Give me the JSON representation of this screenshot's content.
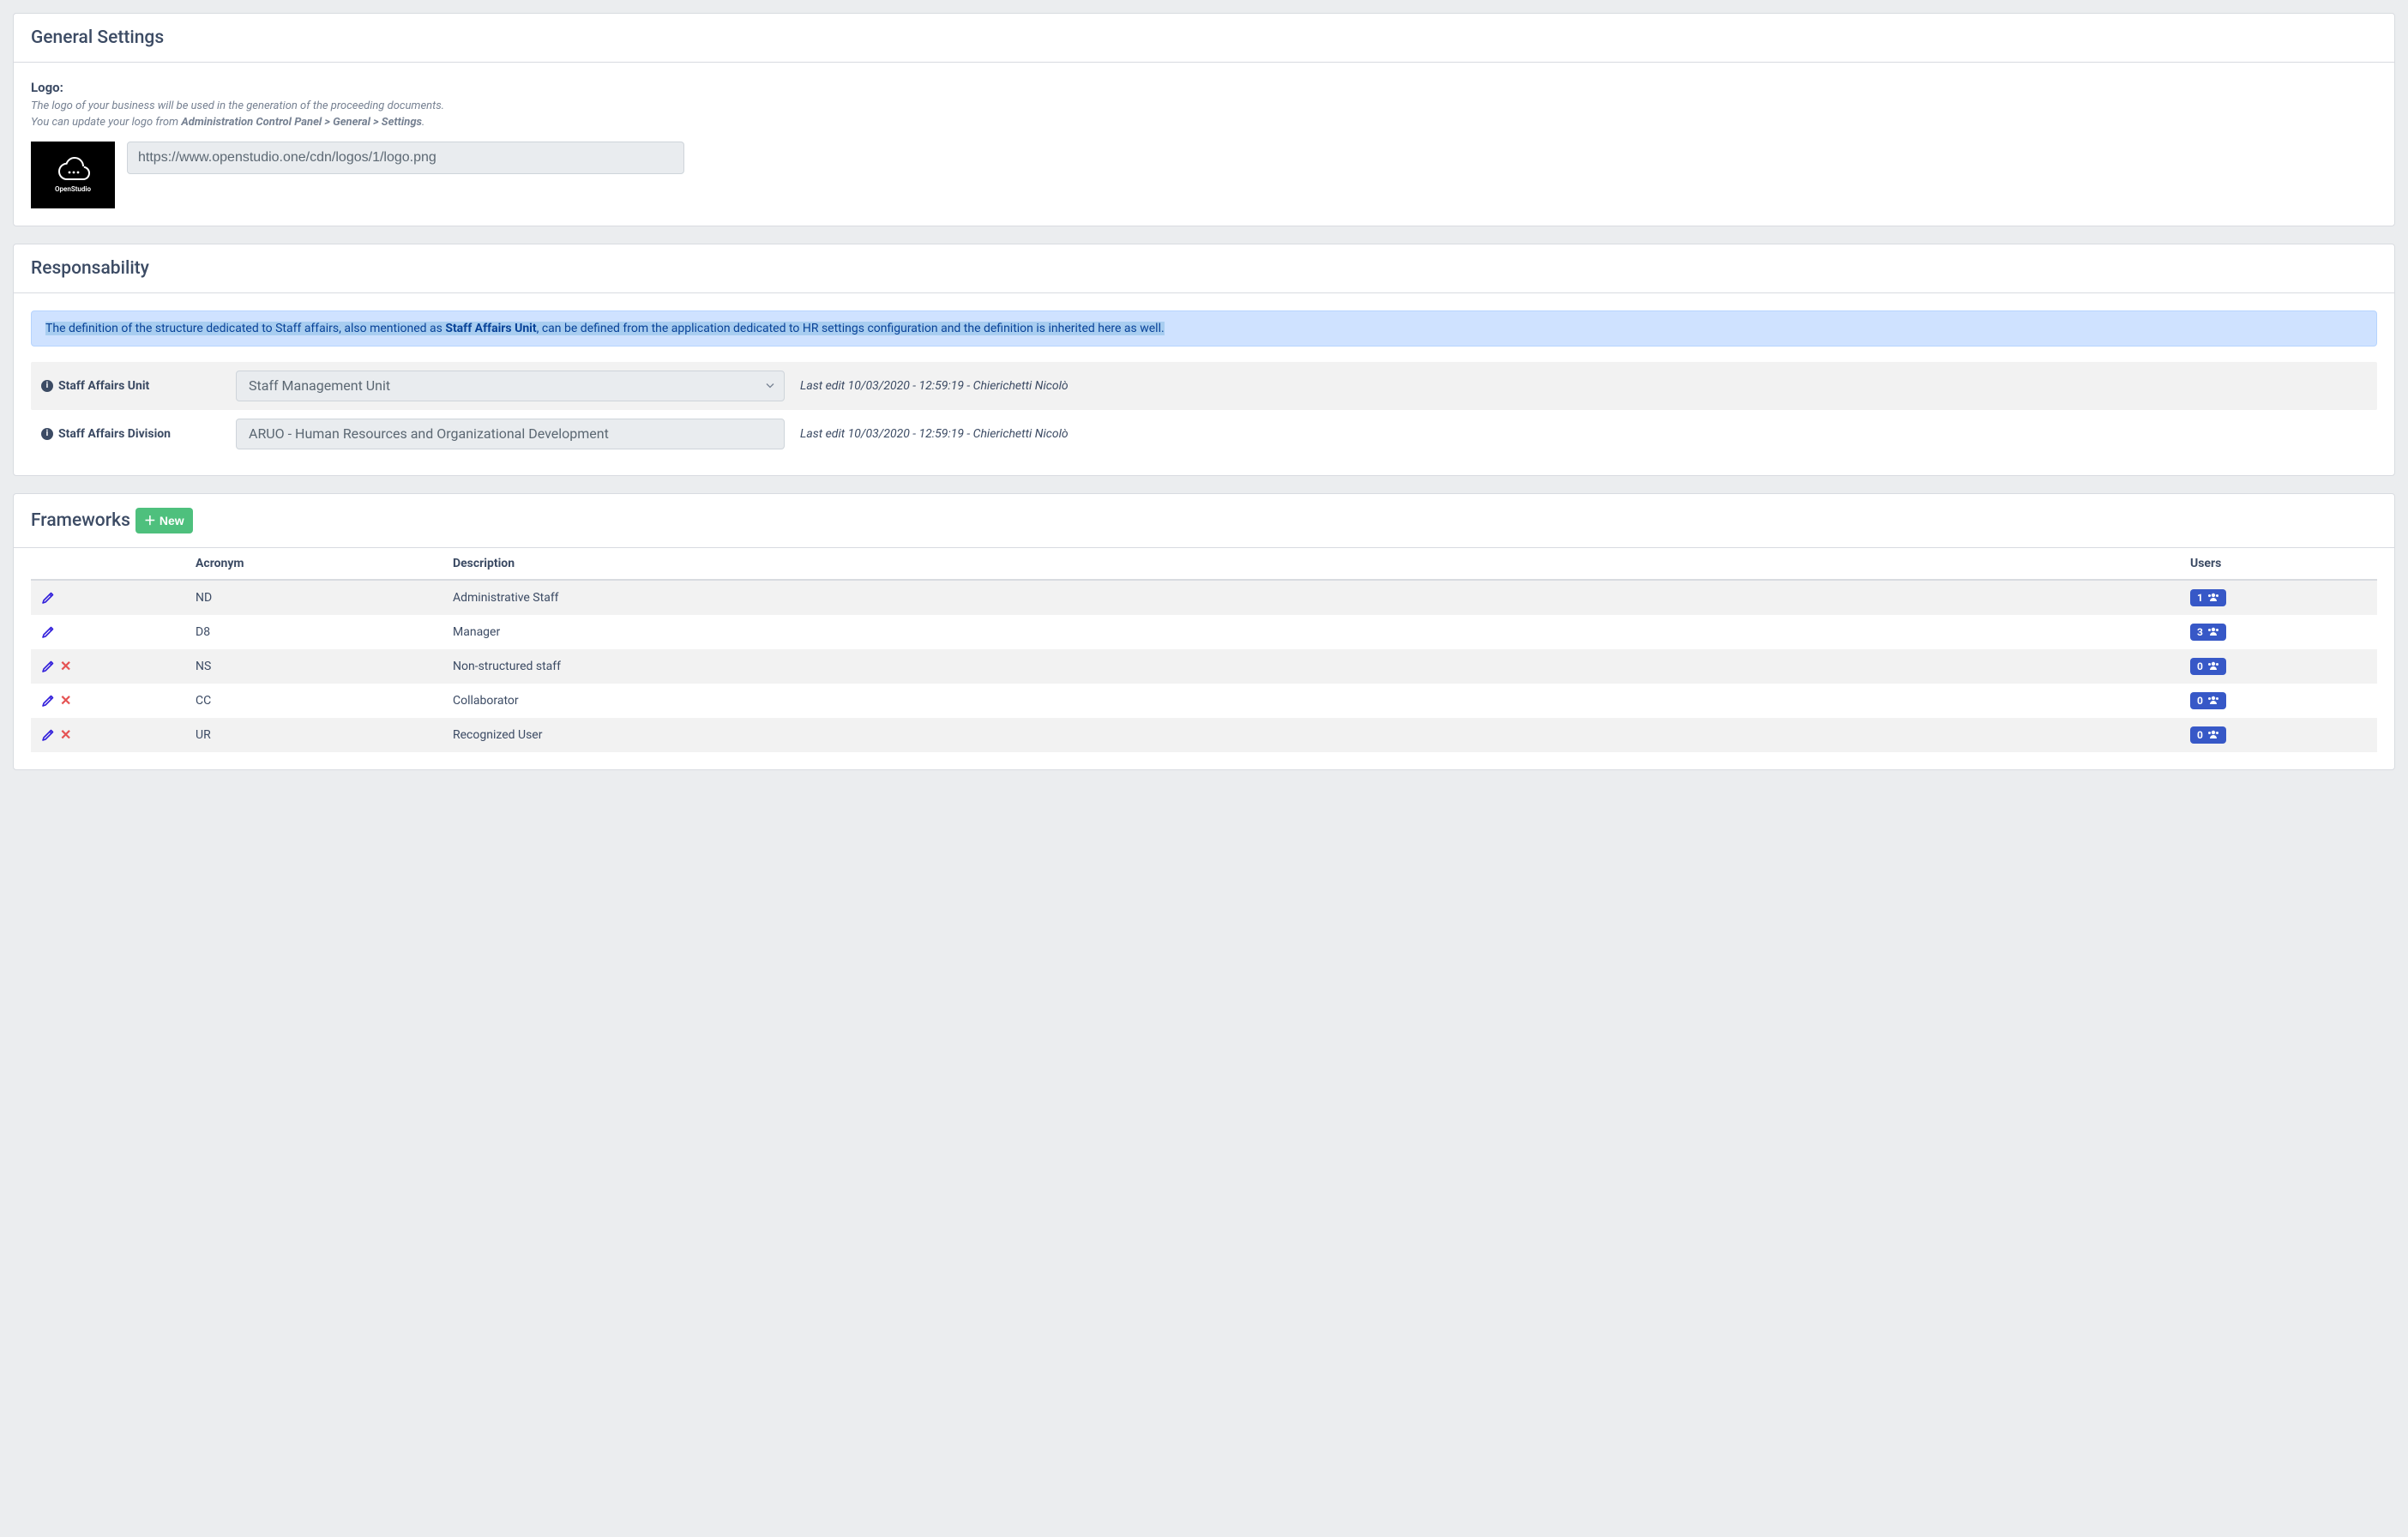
{
  "general": {
    "heading": "General Settings",
    "logo_label": "Logo:",
    "logo_help1": "The logo of your business will be used in the generation of the proceeding documents.",
    "logo_help2_pre": "You can update your logo from ",
    "logo_help2_path": "Administration Control Panel > General > Settings",
    "logo_help2_post": ".",
    "logo_url": "https://www.openstudio.one/cdn/logos/1/logo.png",
    "brand_name": "OpenStudio"
  },
  "responsibility": {
    "heading": "Responsability",
    "alert_pre": "The definition of the structure dedicated to Staff affairs, also mentioned as ",
    "alert_strong": "Staff Affairs Unit",
    "alert_post": ", can be defined from the application dedicated to HR settings configuration and the definition is inherited here as well.",
    "rows": [
      {
        "label": "Staff Affairs Unit",
        "value": "Staff Management Unit",
        "meta": "Last edit 10/03/2020 - 12:59:19 - Chierichetti Nicolò",
        "is_select": true
      },
      {
        "label": "Staff Affairs Division",
        "value": "ARUO - Human Resources and Organizational Development",
        "meta": "Last edit 10/03/2020 - 12:59:19 - Chierichetti Nicolò",
        "is_select": false
      }
    ]
  },
  "frameworks": {
    "heading": "Frameworks",
    "new_label": "New",
    "columns": {
      "acronym": "Acronym",
      "description": "Description",
      "users": "Users"
    },
    "rows": [
      {
        "deletable": false,
        "acronym": "ND",
        "description": "Administrative Staff",
        "users": "1"
      },
      {
        "deletable": false,
        "acronym": "D8",
        "description": "Manager",
        "users": "3"
      },
      {
        "deletable": true,
        "acronym": "NS",
        "description": "Non-structured staff",
        "users": "0"
      },
      {
        "deletable": true,
        "acronym": "CC",
        "description": "Collaborator",
        "users": "0"
      },
      {
        "deletable": true,
        "acronym": "UR",
        "description": "Recognized User",
        "users": "0"
      }
    ]
  }
}
